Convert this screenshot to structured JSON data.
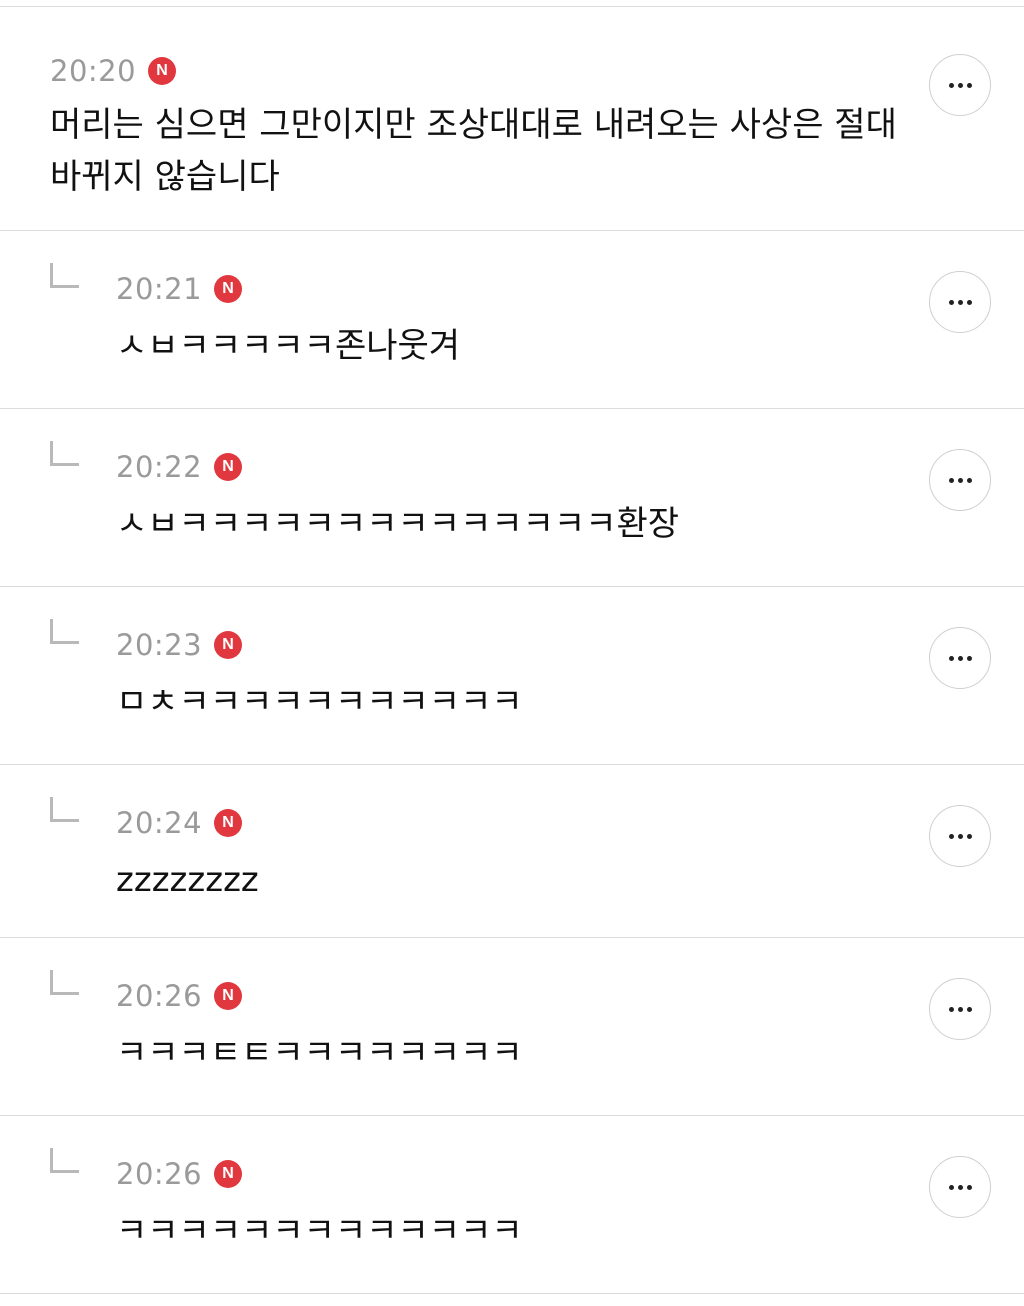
{
  "comments": [
    {
      "time": "20:20",
      "badge": "N",
      "text": "머리는 심으면 그만이지만 조상대대로 내려오는 사상은 절대 바뀌지 않습니다"
    },
    {
      "time": "20:21",
      "badge": "N",
      "text": "ㅅㅂㅋㅋㅋㅋㅋ존나웃겨"
    },
    {
      "time": "20:22",
      "badge": "N",
      "text": "ㅅㅂㅋㅋㅋㅋㅋㅋㅋㅋㅋㅋㅋㅋㅋㅋ환장"
    },
    {
      "time": "20:23",
      "badge": "N",
      "text": "ㅁㅊㅋㅋㅋㅋㅋㅋㅋㅋㅋㅋㅋ"
    },
    {
      "time": "20:24",
      "badge": "N",
      "text": "zzzzzzzz"
    },
    {
      "time": "20:26",
      "badge": "N",
      "text": "ㅋㅋㅋㅌㅌㅋㅋㅋㅋㅋㅋㅋㅋ"
    },
    {
      "time": "20:26",
      "badge": "N",
      "text": "ㅋㅋㅋㅋㅋㅋㅋㅋㅋㅋㅋㅋㅋ"
    }
  ],
  "icons": {
    "badge_color": "#e0383e",
    "reply_icon": "reply-arrow-icon",
    "more_icon": "more-dots-icon"
  }
}
